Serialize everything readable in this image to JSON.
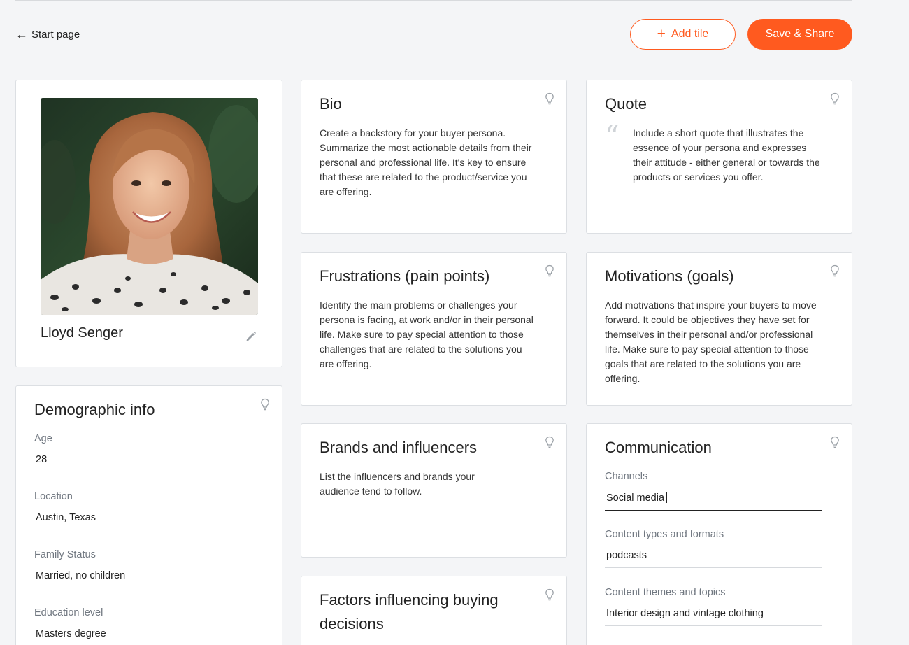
{
  "nav": {
    "back_label": "Start page"
  },
  "actions": {
    "add_tile_label": "Add tile",
    "save_share_label": "Save & Share"
  },
  "colors": {
    "accent": "#ff5a1f",
    "page_bg": "#f4f5f7",
    "card_border": "#dcdfe3"
  },
  "profile": {
    "name": "Lloyd Senger"
  },
  "demographic": {
    "title": "Demographic info",
    "fields": [
      {
        "label": "Age",
        "value": "28"
      },
      {
        "label": "Location",
        "value": "Austin, Texas"
      },
      {
        "label": "Family Status",
        "value": "Married, no children"
      },
      {
        "label": "Education level",
        "value": "Masters degree"
      }
    ]
  },
  "bio": {
    "title": "Bio",
    "text": "Create a backstory for your buyer persona. Summarize the most actionable details from their personal and professional life. It's key to ensure that these are related to the product/service you are offering."
  },
  "quote": {
    "title": "Quote",
    "text": "Include a short quote that illustrates the essence of your persona and expresses their attitude - either general or towards the products or services you offer."
  },
  "frustrations": {
    "title": "Frustrations (pain points)",
    "text": "Identify the main problems or challenges your persona is facing, at work and/or in their personal life. Make sure to pay special attention to those challenges that are related to the solutions you are offering."
  },
  "motivations": {
    "title": "Motivations (goals)",
    "text": "Add motivations that inspire your buyers to move forward. It could be objectives they have set for themselves in their personal and/or professional life. Make sure to pay special attention to those goals that are related to the solutions you are offering."
  },
  "brands": {
    "title": "Brands and influencers",
    "text": "List the influencers and brands your audience tend to follow."
  },
  "communication": {
    "title": "Communication",
    "fields": [
      {
        "label": "Channels",
        "value": "Social media"
      },
      {
        "label": "Content types and formats",
        "value": "podcasts"
      },
      {
        "label": "Content themes and topics",
        "value": "Interior design and vintage clothing"
      }
    ]
  },
  "factors": {
    "title": "Factors influencing buying decisions"
  }
}
